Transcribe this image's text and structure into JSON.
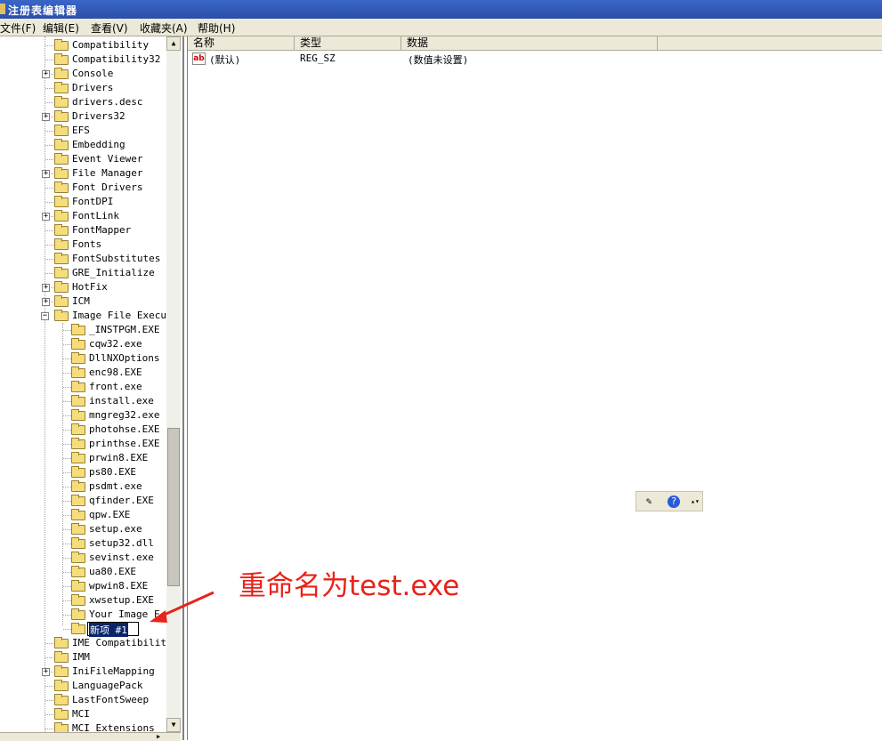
{
  "window": {
    "title": "注册表编辑器"
  },
  "menu": [
    {
      "label": "文件(F)"
    },
    {
      "label": "编辑(E)"
    },
    {
      "label": "查看(V)"
    },
    {
      "label": "收藏夹(A)"
    },
    {
      "label": "帮助(H)"
    }
  ],
  "tree": {
    "top_items": [
      {
        "label": "Compatibility",
        "expandable": false
      },
      {
        "label": "Compatibility32",
        "expandable": false
      },
      {
        "label": "Console",
        "expandable": true
      },
      {
        "label": "Drivers",
        "expandable": false
      },
      {
        "label": "drivers.desc",
        "expandable": false
      },
      {
        "label": "Drivers32",
        "expandable": true
      },
      {
        "label": "EFS",
        "expandable": false
      },
      {
        "label": "Embedding",
        "expandable": false
      },
      {
        "label": "Event Viewer",
        "expandable": false
      },
      {
        "label": "File Manager",
        "expandable": true
      },
      {
        "label": "Font Drivers",
        "expandable": false
      },
      {
        "label": "FontDPI",
        "expandable": false
      },
      {
        "label": "FontLink",
        "expandable": true
      },
      {
        "label": "FontMapper",
        "expandable": false
      },
      {
        "label": "Fonts",
        "expandable": false
      },
      {
        "label": "FontSubstitutes",
        "expandable": false
      },
      {
        "label": "GRE_Initialize",
        "expandable": false
      },
      {
        "label": "HotFix",
        "expandable": true
      },
      {
        "label": "ICM",
        "expandable": true
      }
    ],
    "expanded_item": {
      "label": "Image File Executi"
    },
    "children": [
      "_INSTPGM.EXE",
      "cqw32.exe",
      "DllNXOptions",
      "enc98.EXE",
      "front.exe",
      "install.exe",
      "mngreg32.exe",
      "photohse.EXE",
      "printhse.EXE",
      "prwin8.EXE",
      "ps80.EXE",
      "psdmt.exe",
      "qfinder.EXE",
      "qpw.EXE",
      "setup.exe",
      "setup32.dll",
      "sevinst.exe",
      "ua80.EXE",
      "wpwin8.EXE",
      "xwsetup.EXE",
      "Your Image F"
    ],
    "editing_label": "新项 #1",
    "bottom_items": [
      {
        "label": "IME Compatibility",
        "expandable": false
      },
      {
        "label": "IMM",
        "expandable": false
      },
      {
        "label": "IniFileMapping",
        "expandable": true
      },
      {
        "label": "LanguagePack",
        "expandable": false
      },
      {
        "label": "LastFontSweep",
        "expandable": false
      },
      {
        "label": "MCI",
        "expandable": false
      },
      {
        "label": "MCI Extensions",
        "expandable": false
      }
    ]
  },
  "list": {
    "columns": [
      "名称",
      "类型",
      "数据"
    ],
    "rows": [
      {
        "name": "(默认)",
        "type": "REG_SZ",
        "data": "(数值未设置)",
        "icon": "string-value-icon"
      }
    ]
  },
  "annotation": {
    "text": "重命名为test.exe",
    "color": "#e8231a"
  },
  "colors": {
    "titlebar": "#2a4fa8",
    "selection": "#0a246a",
    "folder": "#f6dd7b"
  }
}
